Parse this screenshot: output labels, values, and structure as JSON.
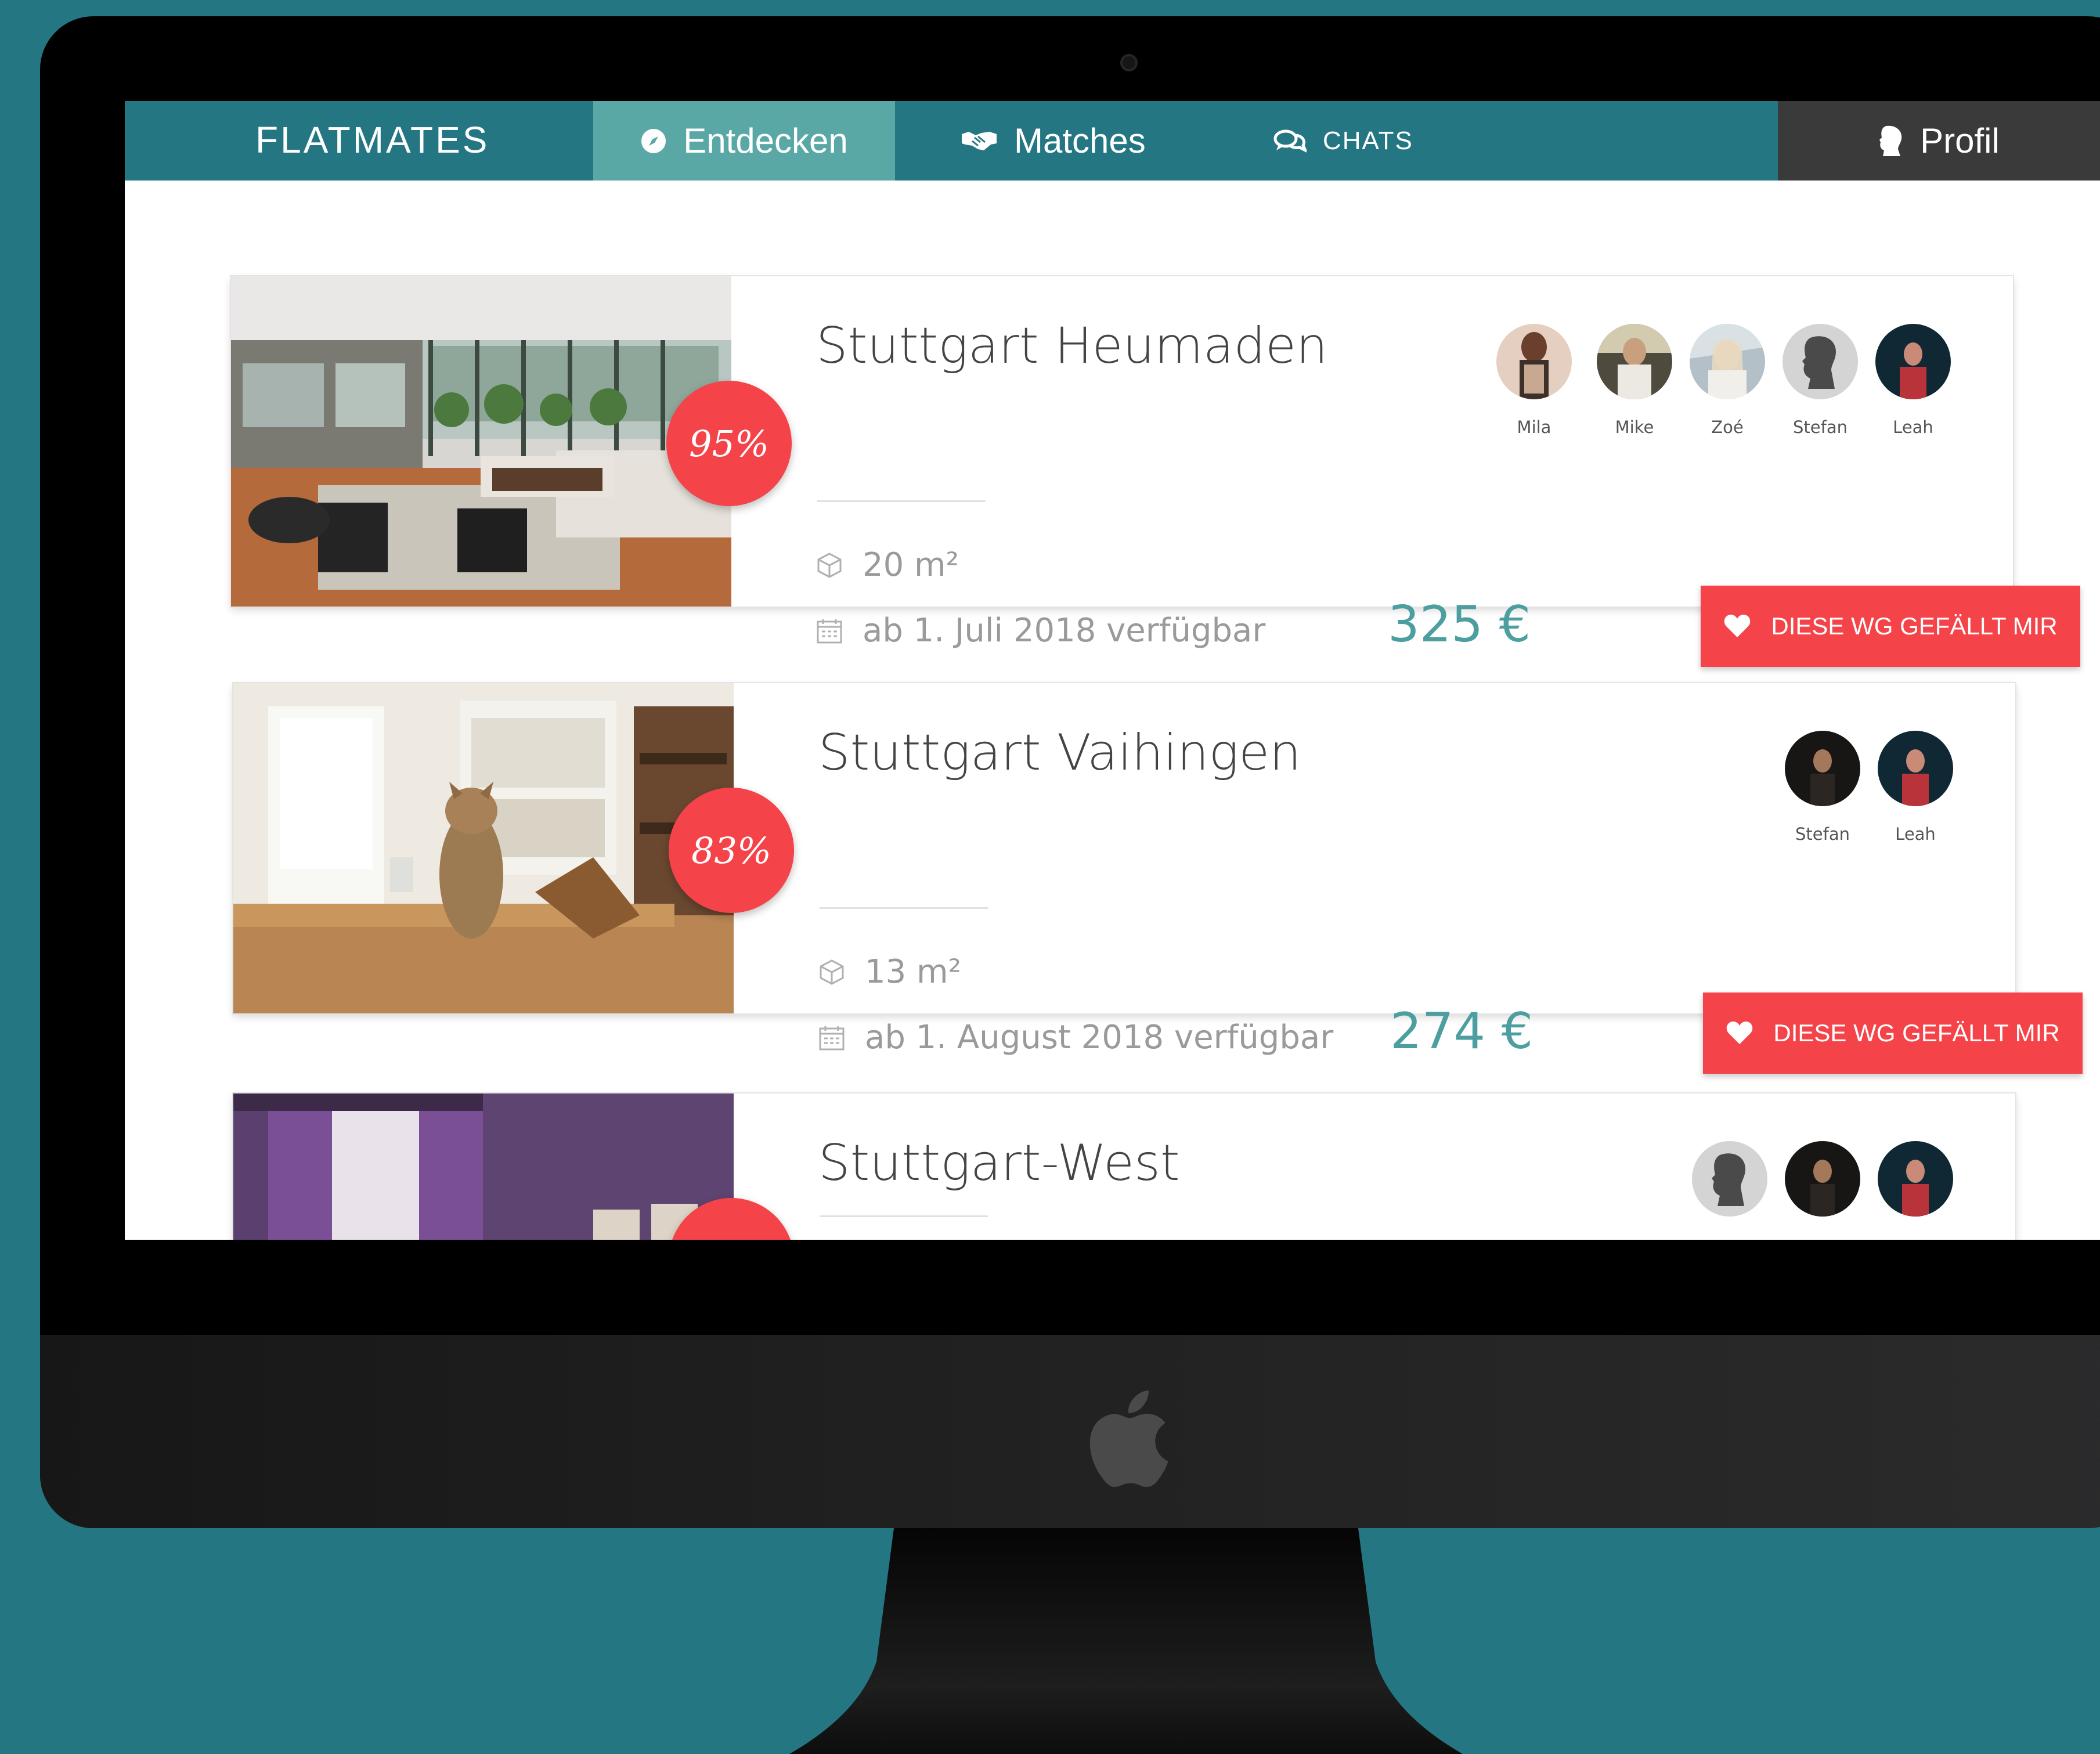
{
  "app": {
    "logo": "FLATMATES"
  },
  "nav": {
    "items": [
      {
        "label": "Entdecken",
        "icon": "compass-icon",
        "active": true
      },
      {
        "label": "Matches",
        "icon": "handshake-icon"
      },
      {
        "label": "CHATS",
        "icon": "chat-bubbles-icon"
      }
    ],
    "profile": {
      "label": "Profil",
      "icon": "user-silhouette-icon"
    }
  },
  "listings": [
    {
      "title": "Stuttgart Heumaden",
      "match": "95%",
      "size": "20 m²",
      "availability": "ab 1. Juli 2018 verfügbar",
      "price": "325 €",
      "button": "DIESE WG GEFÄLLT MIR",
      "flatmates": [
        "Mila",
        "Mike",
        "Zoé",
        "Stefan",
        "Leah"
      ]
    },
    {
      "title": "Stuttgart Vaihingen",
      "match": "83%",
      "size": "13 m²",
      "availability": "ab 1. August 2018 verfügbar",
      "price": "274 €",
      "button": "DIESE WG GEFÄLLT MIR",
      "flatmates": [
        "Stefan",
        "Leah"
      ]
    },
    {
      "title": "Stuttgart-West"
    }
  ],
  "colors": {
    "background": "#247682",
    "navbar": "#247682",
    "nav_active": "#5aa8a6",
    "nav_profile": "#3a3a3a",
    "accent_red": "#f5434a",
    "price_teal": "#4c9ea0"
  }
}
